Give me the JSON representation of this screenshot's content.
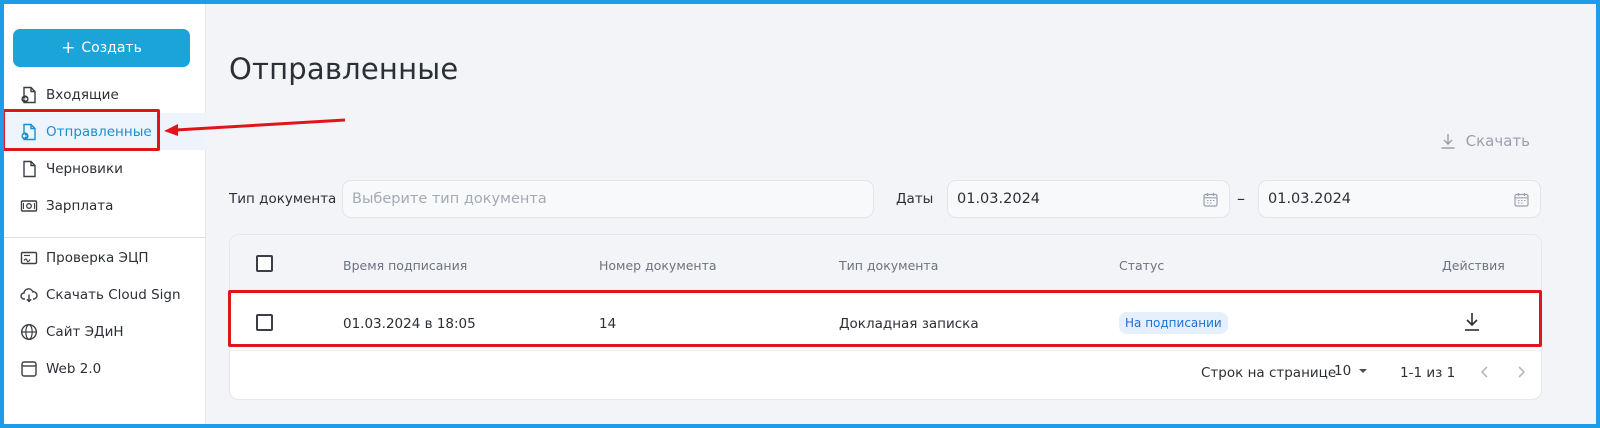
{
  "sidebar": {
    "create_label": "Создать",
    "items": [
      {
        "label": "Входящие",
        "icon": "inbox-doc-icon"
      },
      {
        "label": "Отправленные",
        "icon": "sent-doc-icon",
        "active": true
      },
      {
        "label": "Черновики",
        "icon": "draft-doc-icon"
      },
      {
        "label": "Зарплата",
        "icon": "money-icon"
      }
    ],
    "tools": [
      {
        "label": "Проверка ЭЦП",
        "icon": "signature-icon"
      },
      {
        "label": "Скачать Cloud Sign",
        "icon": "cloud-download-icon"
      },
      {
        "label": "Сайт ЭДиН",
        "icon": "globe-icon"
      },
      {
        "label": "Web 2.0",
        "icon": "window-icon"
      }
    ]
  },
  "main": {
    "title": "Отправленные",
    "download_label": "Скачать",
    "filters": {
      "doc_type_label": "Тип документа",
      "doc_type_placeholder": "Выберите тип документа",
      "dates_label": "Даты",
      "date_from": "01.03.2024",
      "date_to": "01.03.2024",
      "date_separator": "–"
    },
    "table": {
      "columns": [
        "Время подписания",
        "Номер документа",
        "Тип документа",
        "Статус",
        "Действия"
      ],
      "rows": [
        {
          "time": "01.03.2024 в 18:05",
          "number": "14",
          "type": "Докладная записка",
          "status": "На подписании"
        }
      ]
    },
    "pagination": {
      "rows_per_page_label": "Строк на странице",
      "rows_per_page": "10",
      "range": "1-1 из 1"
    }
  },
  "colors": {
    "accent": "#1aa4d8",
    "frame": "#1e9be9",
    "highlight": "#e0141b",
    "status_bg": "#e6f0fd",
    "status_text": "#1f6fd8"
  }
}
